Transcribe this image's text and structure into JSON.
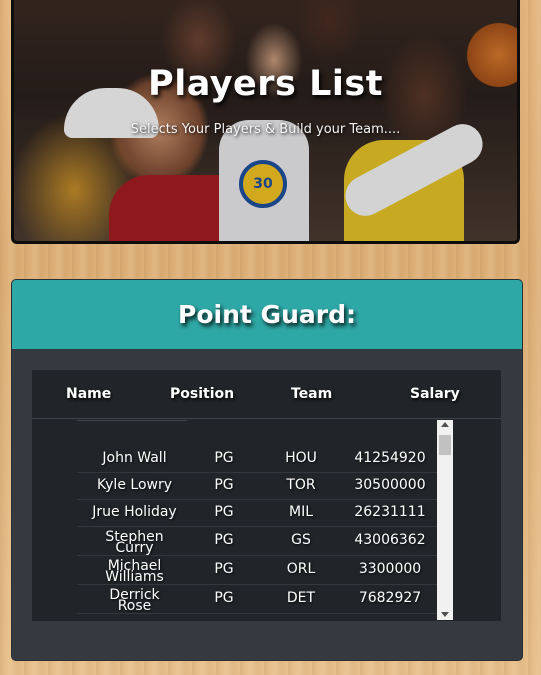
{
  "banner": {
    "title": "Players List",
    "subtitle": "Selects Your Players & Build your Team...."
  },
  "card": {
    "title": "Point Guard:"
  },
  "table": {
    "headers": {
      "name": "Name",
      "position": "Position",
      "team": "Team",
      "salary": "Salary"
    },
    "rows": [
      {
        "name": "John Wall",
        "position": "PG",
        "team": "HOU",
        "salary": "41254920"
      },
      {
        "name": "Kyle Lowry",
        "position": "PG",
        "team": "TOR",
        "salary": "30500000"
      },
      {
        "name": "Jrue Holiday",
        "position": "PG",
        "team": "MIL",
        "salary": "26231111"
      },
      {
        "name_line1": "Stephen",
        "name_line2": "Curry",
        "position": "PG",
        "team": "GS",
        "salary": "43006362"
      },
      {
        "name_line1": "Michael",
        "name_line2": "Williams",
        "position": "PG",
        "team": "ORL",
        "salary": "3300000"
      },
      {
        "name_line1": "Derrick",
        "name_line2": "Rose",
        "position": "PG",
        "team": "DET",
        "salary": "7682927"
      }
    ]
  },
  "icons": {
    "scroll_up": "arrow-up-icon",
    "scroll_down": "arrow-down-icon"
  },
  "colors": {
    "header_teal": "#2ea8a6",
    "card_bg": "#343a40",
    "table_bg": "#212529"
  }
}
